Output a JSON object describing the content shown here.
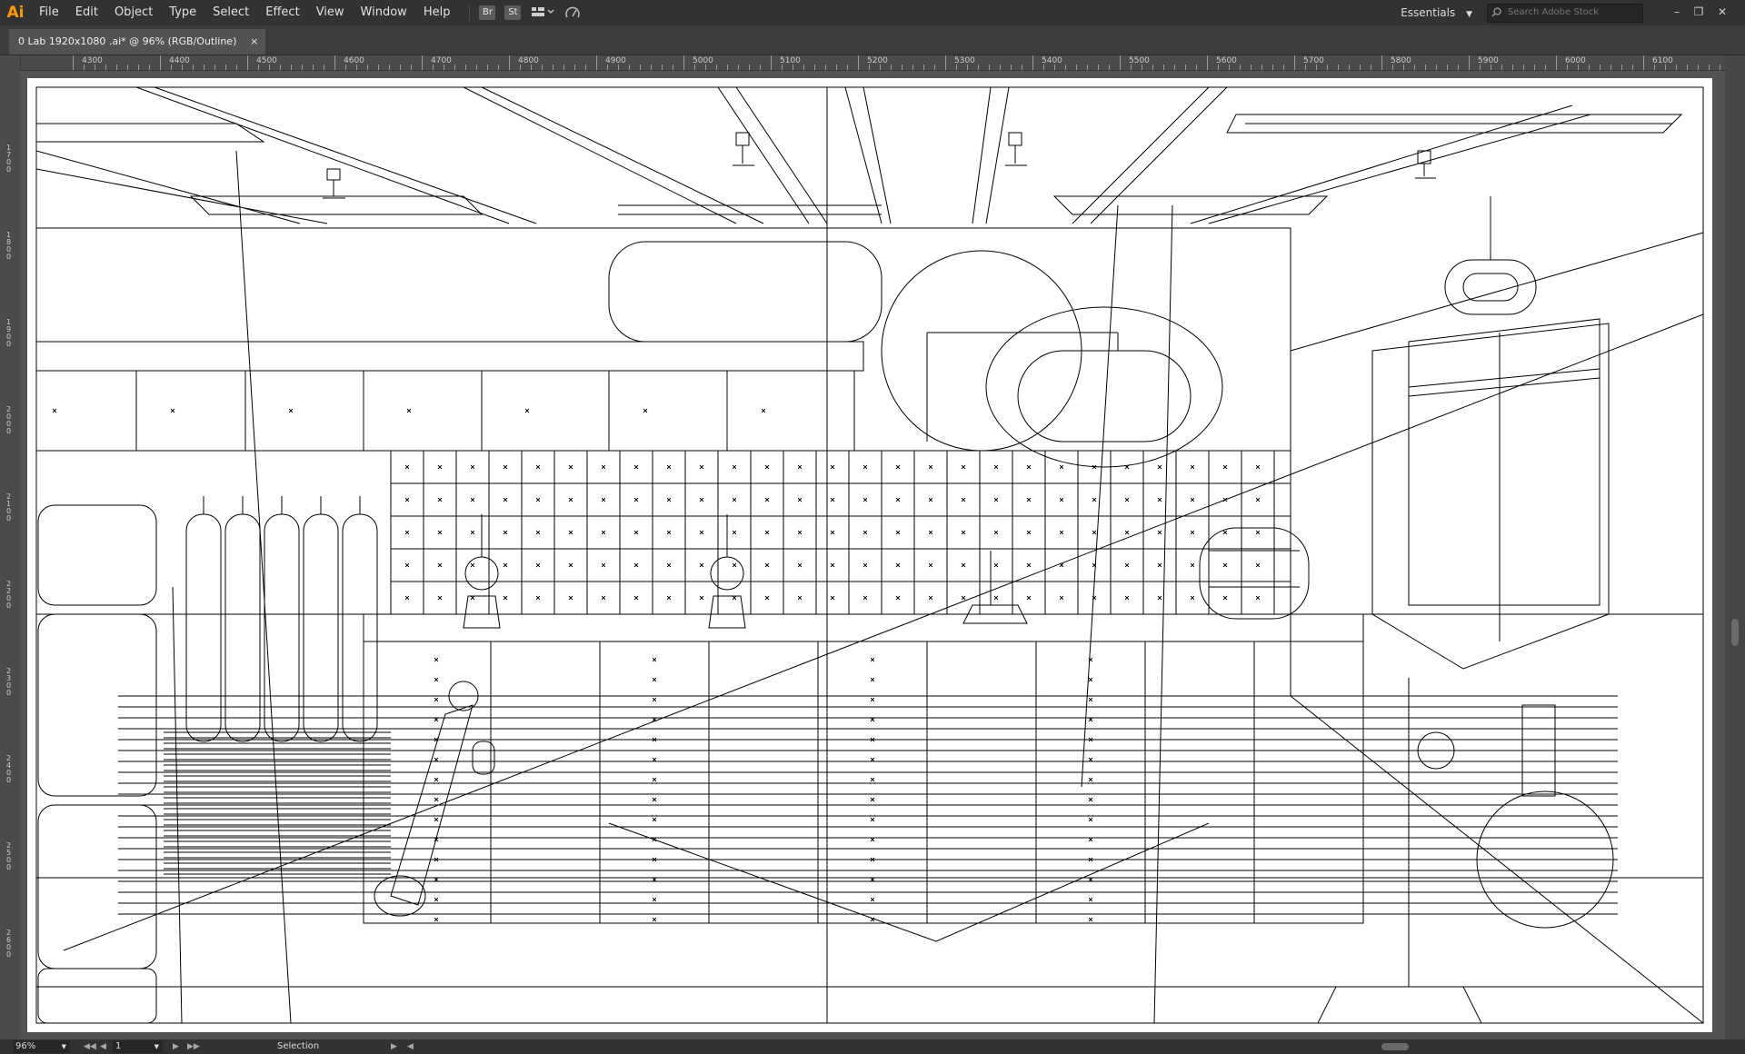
{
  "app": {
    "logo": "Ai"
  },
  "menu": [
    "File",
    "Edit",
    "Object",
    "Type",
    "Select",
    "Effect",
    "View",
    "Window",
    "Help"
  ],
  "toolbar_icons": [
    {
      "name": "bridge-icon",
      "label": "Br"
    },
    {
      "name": "stock-icon",
      "label": "St"
    }
  ],
  "workspace": {
    "label": "Essentials"
  },
  "search": {
    "placeholder": "Search Adobe Stock"
  },
  "document_tab": {
    "title": "0 Lab 1920x1080 .ai* @ 96% (RGB/Outline)",
    "close": "×"
  },
  "ruler": {
    "top": [
      "4300",
      "4400",
      "4500",
      "4600",
      "4700",
      "4800",
      "4900",
      "5000",
      "5100",
      "5200",
      "5300",
      "5400",
      "5500",
      "5600",
      "5700",
      "5800",
      "5900",
      "6000",
      "6100"
    ],
    "left": [
      "1700",
      "1800",
      "1900",
      "2000",
      "2100",
      "2200",
      "2300",
      "2400",
      "2500",
      "2600"
    ]
  },
  "status": {
    "zoom": "96%",
    "artboard": "1",
    "tool": "Selection"
  },
  "colors": {
    "chrome": "#323232",
    "canvas": "#535353",
    "accent": "#ff9a00",
    "outline": "#000000"
  }
}
